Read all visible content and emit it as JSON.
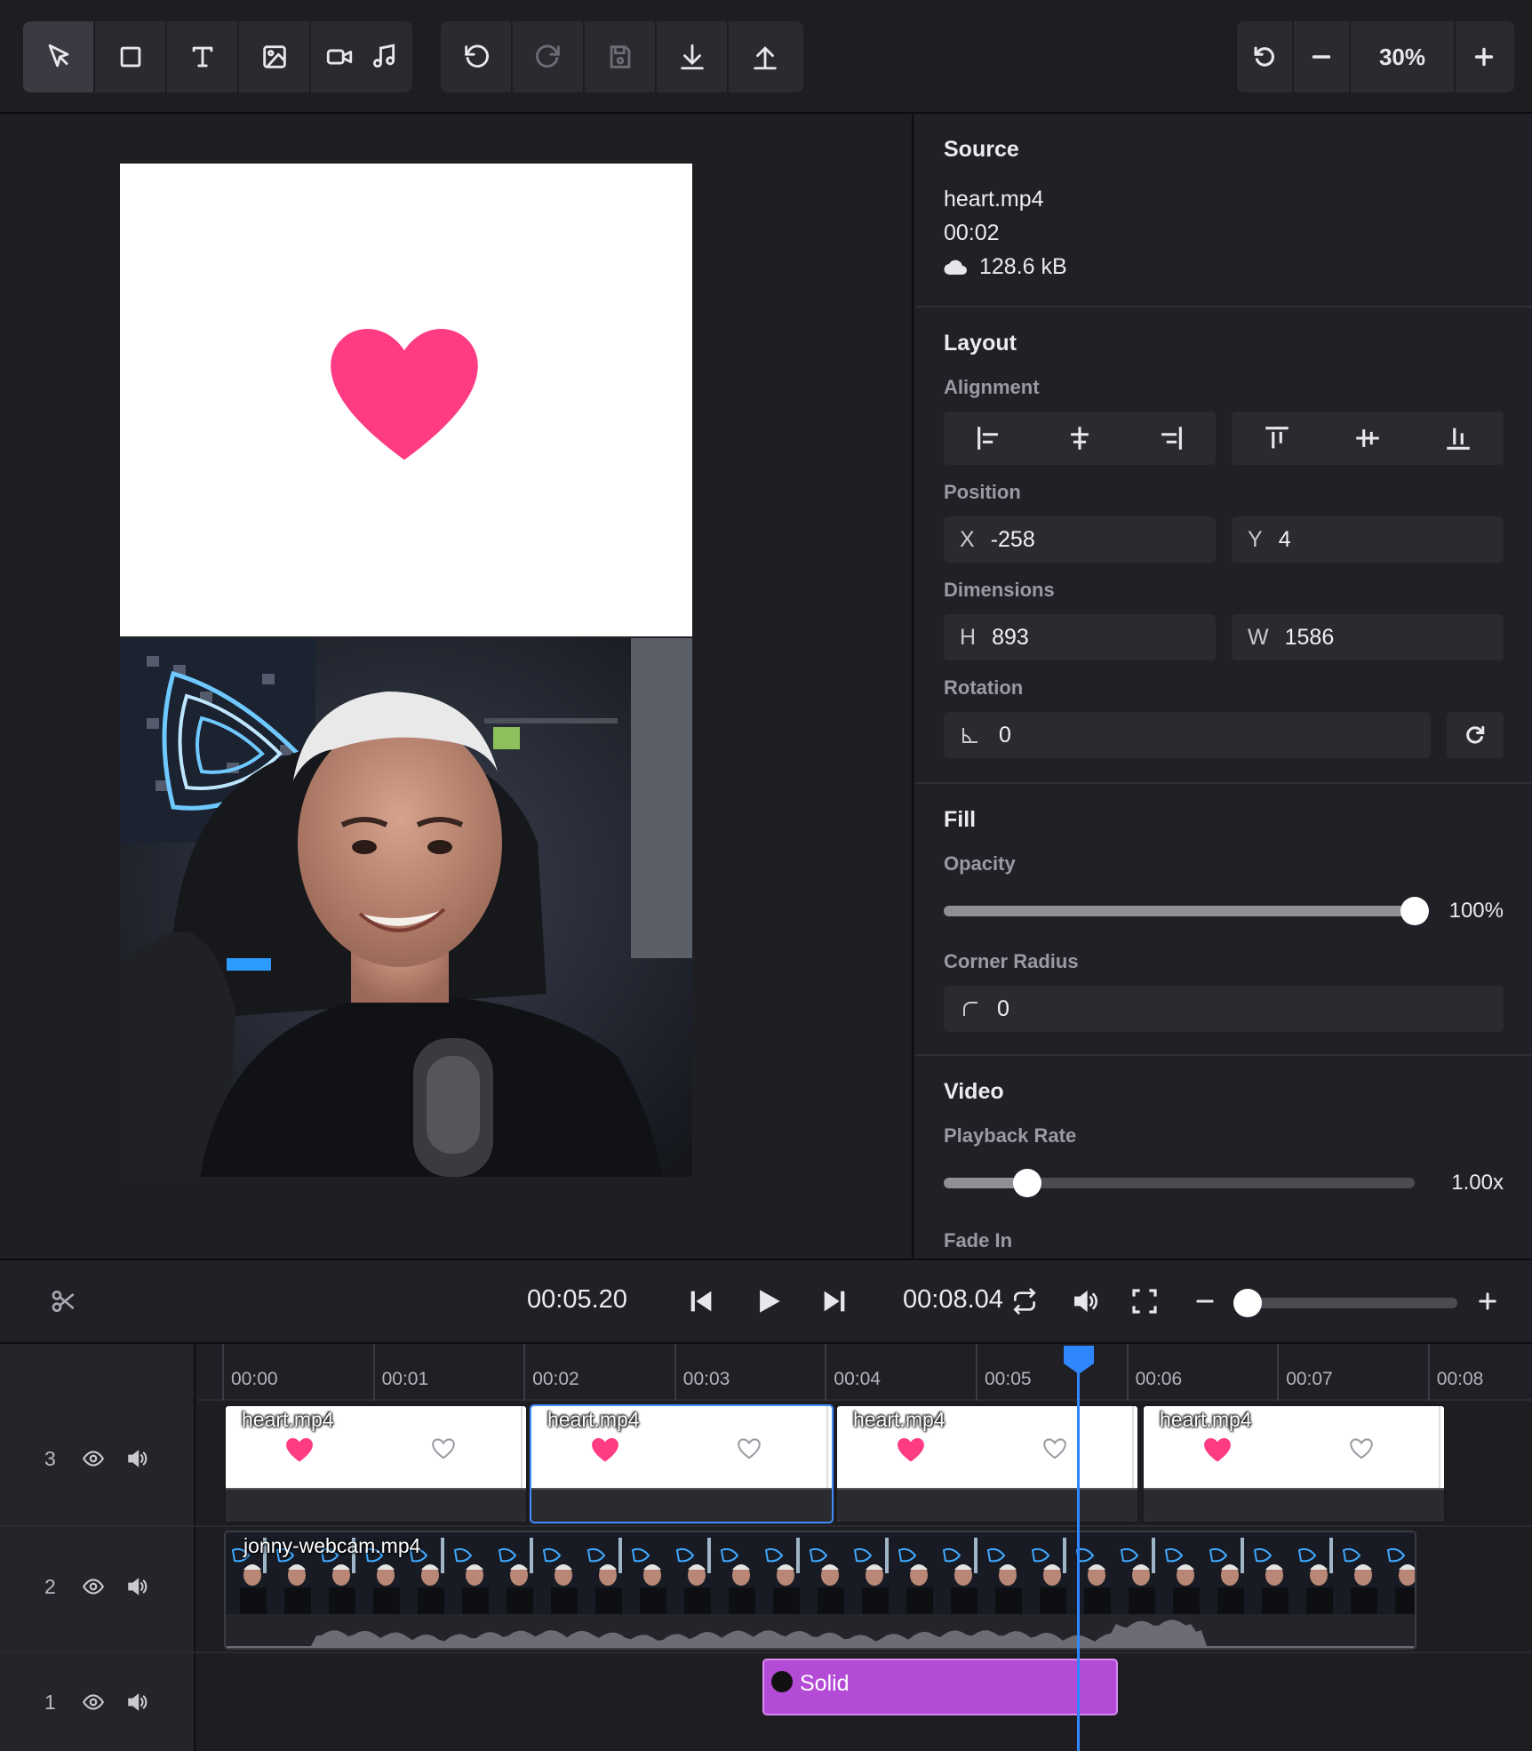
{
  "toolbar": {
    "tools": [
      "select-tool",
      "rectangle-tool",
      "text-tool",
      "image-tool",
      "video-tool",
      "audio-tool"
    ],
    "history": [
      "undo",
      "redo",
      "save",
      "download",
      "upload"
    ],
    "zoom": {
      "value": "30%"
    }
  },
  "source": {
    "title": "Source",
    "filename": "heart.mp4",
    "duration": "00:02",
    "size": "128.6 kB"
  },
  "layout": {
    "title": "Layout",
    "alignment_label": "Alignment",
    "position_label": "Position",
    "x_label": "X",
    "x_value": "-258",
    "y_label": "Y",
    "y_value": "4",
    "dimensions_label": "Dimensions",
    "h_label": "H",
    "h_value": "893",
    "w_label": "W",
    "w_value": "1586",
    "rotation_label": "Rotation",
    "rotation_value": "0"
  },
  "fill": {
    "title": "Fill",
    "opacity_label": "Opacity",
    "opacity_value": "100%",
    "opacity_fraction": 1.0,
    "corner_label": "Corner Radius",
    "corner_value": "0"
  },
  "video": {
    "title": "Video",
    "rate_label": "Playback Rate",
    "rate_value": "1.00x",
    "fade_in_label": "Fade In"
  },
  "transport": {
    "current_time": "00:05.20",
    "total_time": "00:08.04",
    "zoom_fraction": 0.05
  },
  "timeline": {
    "ticks": [
      "00:00",
      "00:01",
      "00:02",
      "00:03",
      "00:04",
      "00:05",
      "00:06",
      "00:07",
      "00:08"
    ],
    "tracks": [
      {
        "num": "3",
        "clip_label": "heart.mp4"
      },
      {
        "num": "2",
        "clip_label": "jonny-webcam.mp4"
      },
      {
        "num": "1",
        "clip_label": "Solid"
      }
    ],
    "heart_clips": [
      "heart.mp4",
      "heart.mp4",
      "heart.mp4",
      "heart.mp4"
    ],
    "solid_color": "#b44bd6",
    "playhead_color": "#2f86ff"
  }
}
